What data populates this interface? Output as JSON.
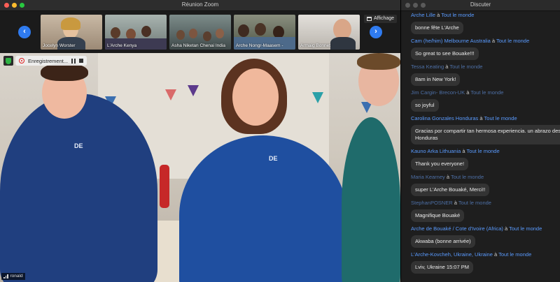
{
  "zoom": {
    "title": "Réunion Zoom",
    "view_label": "Affichage",
    "recording_label": "Enregistrement...",
    "self_name": "ronald",
    "participants": [
      {
        "name": "Jocelyn Worster"
      },
      {
        "name": "L'Arche Kenya"
      },
      {
        "name": "Asha Niketan Chenai India"
      },
      {
        "name": "Arche Nongr-Maasem -"
      },
      {
        "name": "Armaig Bonnet"
      }
    ],
    "jacket_text": "DE"
  },
  "chat": {
    "title": "Discuter",
    "to_label": "à",
    "audience": "Tout le monde",
    "messages": [
      {
        "sender": "Arche Lille",
        "text": "bonne fête L'Arche"
      },
      {
        "sender": "Cam (he/him) Melbourne Australia",
        "text": "So great to see Bouake!!!"
      },
      {
        "sender": "Tessa Keating",
        "text": "8am in New York!"
      },
      {
        "sender": "Jim Cargin- Brecon-UK",
        "text": "so joyful"
      },
      {
        "sender": "Carolina Gonzales Honduras",
        "text": "Gracias por compartir tan hermosa experiencia.  un abrazo desde Honduras"
      },
      {
        "sender": "Kauno Arka Lithuania",
        "text": "Thank you everyone!"
      },
      {
        "sender": "Maria Kearney",
        "text": "super L'Arche Bouaké, Merci!!"
      },
      {
        "sender": "StephanPOSNER",
        "text": "Magnifique Bouaké"
      },
      {
        "sender": "Arche de Bouaké / Cote d'Ivoire (Africa)",
        "text": "Akwaba (bonne arrivée)"
      },
      {
        "sender": "L'Arche-Kovcheh, Ukraine, Ukraine",
        "text": "Lviv, Ukraine   15:07 PM"
      }
    ]
  },
  "colors": {
    "accent_blue": "#2f7bf0",
    "sender_blue": "#5a9bff",
    "rec_red": "#e02020",
    "secure_green": "#2fb344"
  }
}
